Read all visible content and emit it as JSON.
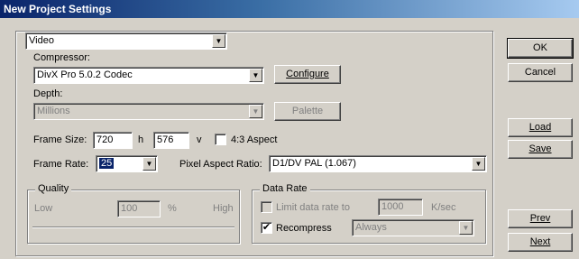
{
  "window": {
    "title": "New Project Settings"
  },
  "category": {
    "value": "Video"
  },
  "compressor": {
    "label": "Compressor:",
    "value": "DivX Pro 5.0.2 Codec",
    "configure_button": "Configure"
  },
  "depth": {
    "label": "Depth:",
    "value": "Millions",
    "palette_button": "Palette"
  },
  "frame_size": {
    "label": "Frame Size:",
    "width": "720",
    "h_label": "h",
    "height": "576",
    "v_label": "v",
    "aspect_label": "4:3 Aspect",
    "aspect_checked": false
  },
  "frame_rate": {
    "label": "Frame Rate:",
    "value": "25"
  },
  "pixel_aspect": {
    "label": "Pixel Aspect Ratio:",
    "value": "D1/DV PAL (1.067)"
  },
  "quality": {
    "title": "Quality",
    "low": "Low",
    "value": "100",
    "percent": "%",
    "high": "High"
  },
  "data_rate": {
    "title": "Data Rate",
    "limit_label": "Limit data rate to",
    "limit_value": "1000",
    "limit_unit": "K/sec",
    "limit_checked": false,
    "recompress_label": "Recompress",
    "recompress_checked": true,
    "recompress_value": "Always",
    "check_mark": "✔"
  },
  "buttons": {
    "ok": "OK",
    "cancel": "Cancel",
    "load": "Load",
    "save": "Save",
    "prev": "Prev",
    "next": "Next"
  },
  "icons": {
    "dropdown_arrow": "▼"
  }
}
